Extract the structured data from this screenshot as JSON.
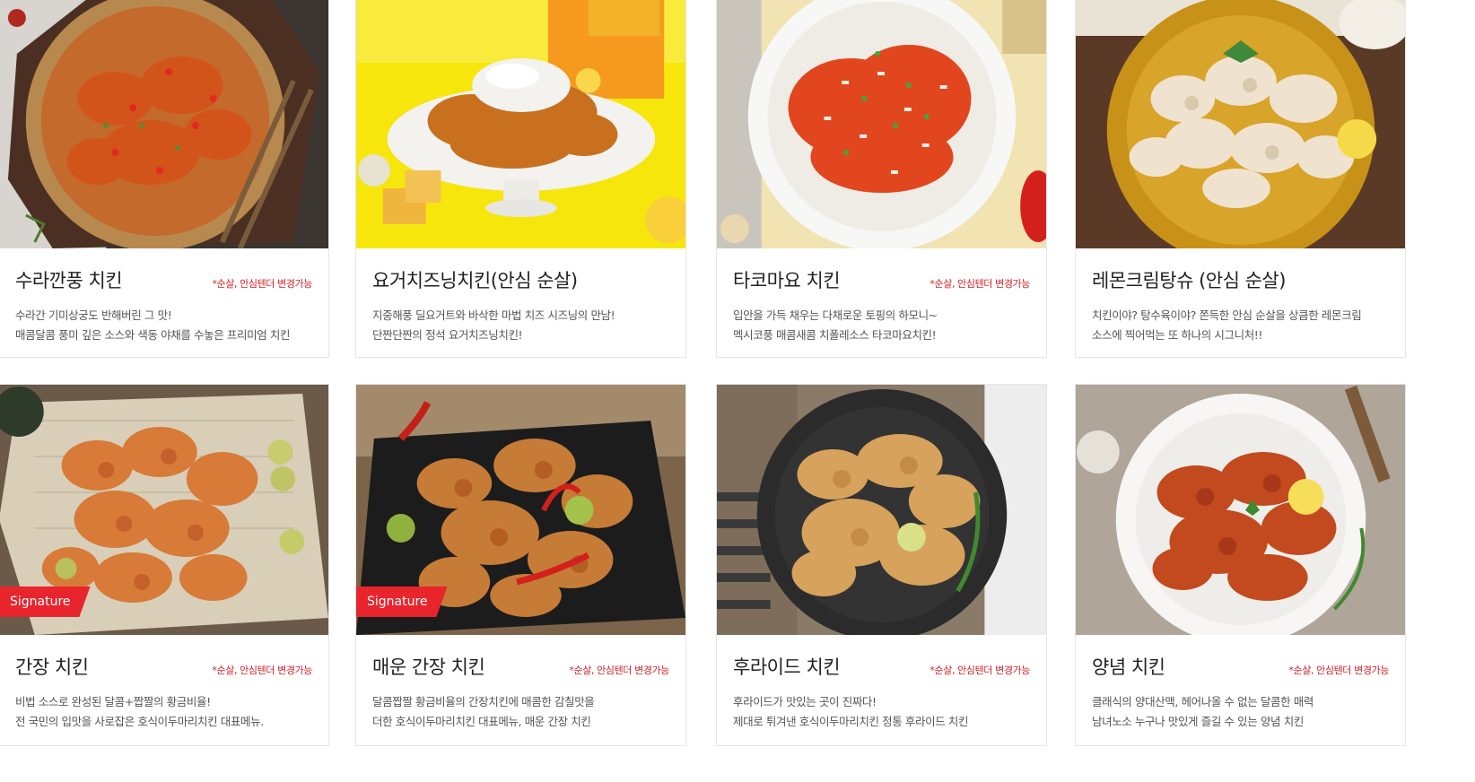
{
  "menu": [
    {
      "title": "수라깐풍 치킨",
      "option": "*순살, 안심텐더 변경가능",
      "desc1": "수라간 기미상궁도 반해버린 그 맛!",
      "desc2": "매콤달콤 풍미 깊은 소스와 색동 야채를 수놓은 프리미엄 치킨",
      "badge": "",
      "image": "kkanpung-chicken-photo"
    },
    {
      "title": "요거치즈닝치킨(안심 순살)",
      "option": "",
      "desc1": "지중해풍 딜요거트와 바삭한 마법 치즈 시즈닝의 만남!",
      "desc2": "단짠단짠의 정석 요거치즈닝치킨!",
      "badge": "",
      "image": "yogurt-cheese-chicken-photo"
    },
    {
      "title": "타코마요 치킨",
      "option": "*순살, 안심텐더 변경가능",
      "desc1": "입안을 가득 채우는 다채로운 토핑의 하모니~",
      "desc2": "멕시코풍 매콤새콤 치폴레소스 타코마요치킨!",
      "badge": "",
      "image": "taco-mayo-chicken-photo"
    },
    {
      "title": "레몬크림탕슈 (안심 순살)",
      "option": "",
      "desc1": "치킨이야? 탕수육이야?  쫀득한 안심 순살을 상큼한 레몬크림",
      "desc2": "소스에 찍어먹는 또 하나의 시그니처!!",
      "badge": "",
      "image": "lemon-cream-chicken-photo"
    },
    {
      "title": "간장 치킨",
      "option": "*순살, 안심텐더 변경가능",
      "desc1": "비법 소스로 완성된 달콤+짭짤의 황금비율!",
      "desc2": "전 국민의 입맛을 사로잡은 호식이두마리치킨 대표메뉴.",
      "badge": "Signature",
      "image": "soy-sauce-chicken-photo"
    },
    {
      "title": "매운 간장 치킨",
      "option": "*순살, 안심텐더 변경가능",
      "desc1": "달콤짭짤 황금비율의 간장치킨에 매콤한 감칠맛을",
      "desc2": "더한 호식이두마리치킨 대표메뉴, 매운 간장 치킨",
      "badge": "Signature",
      "image": "spicy-soy-chicken-photo"
    },
    {
      "title": "후라이드 치킨",
      "option": "*순살, 안심텐더 변경가능",
      "desc1": "후라이드가 맛있는 곳이 진짜다!",
      "desc2": "제대로 튀겨낸 호식이두마리치킨 정통 후라이드 치킨",
      "badge": "",
      "image": "fried-chicken-photo"
    },
    {
      "title": "양념 치킨",
      "option": "*순살, 안심텐더 변경가능",
      "desc1": "클래식의 양대산맥, 헤어나올 수 없는 달콤한 매력",
      "desc2": "남녀노소 누구나 맛있게 즐길 수 있는 양념 치킨",
      "badge": "",
      "image": "yangnyeom-chicken-photo"
    }
  ],
  "colors": {
    "accent": "#e8242c",
    "option_text": "#d21f26",
    "title_text": "#222222",
    "desc_text": "#555555"
  }
}
